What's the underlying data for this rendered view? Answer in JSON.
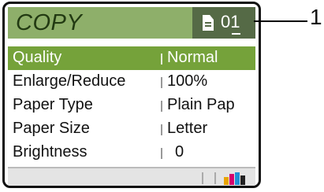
{
  "lcd": {
    "mode_title": "COPY",
    "copies": {
      "icon": "document-icon",
      "count": "01"
    },
    "menu_items": [
      {
        "label": "Quality",
        "value": "Normal"
      },
      {
        "label": "Enlarge/Reduce",
        "value": "100%"
      },
      {
        "label": "Paper Type",
        "value": "Plain Pap"
      },
      {
        "label": "Paper Size",
        "value": "Letter"
      },
      {
        "label": "Brightness",
        "value": "0"
      }
    ],
    "selected_index": 0,
    "status_icon": "ink-level-icon",
    "colors": {
      "header_bg": "#8eaf6a",
      "copies_bg": "#556a46",
      "selected_bg": "#75a23a",
      "ink": [
        "#e8a400",
        "#d4006e",
        "#1e8fd6",
        "#222222"
      ]
    }
  },
  "callout": {
    "label": "1"
  }
}
